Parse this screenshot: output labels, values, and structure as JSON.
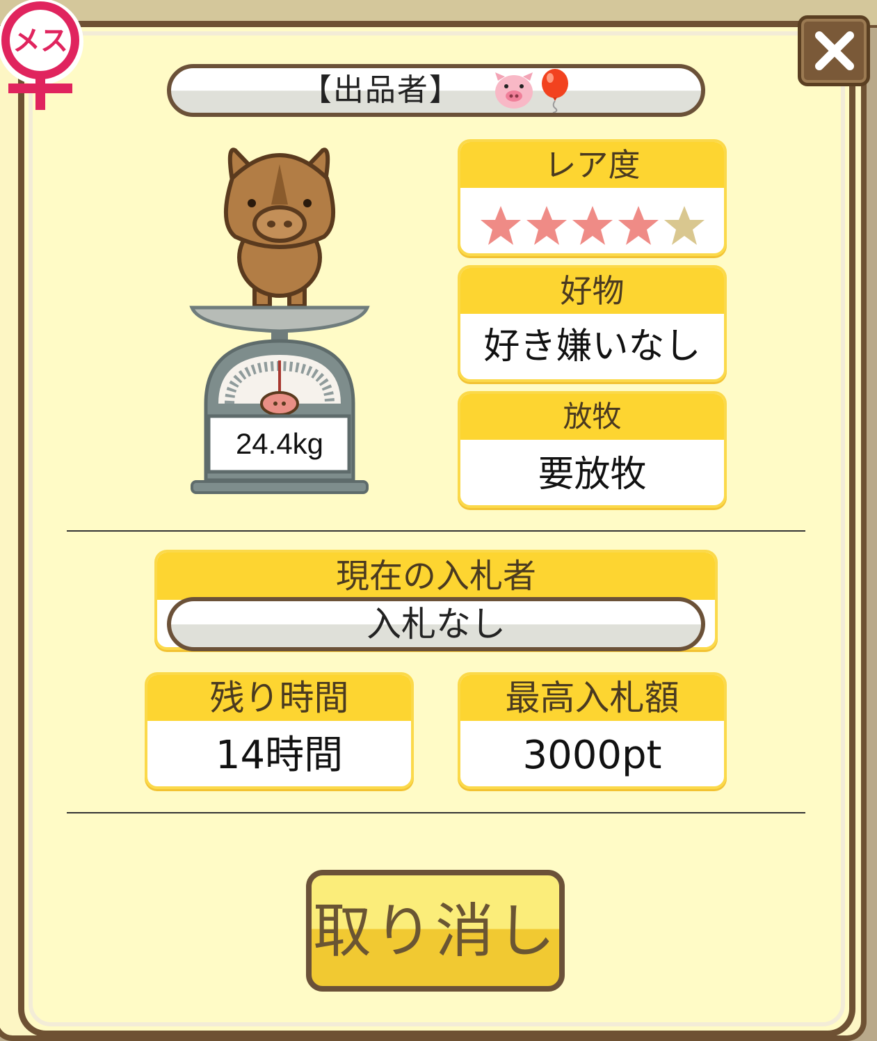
{
  "gender": {
    "label": "メス",
    "icon": "female-symbol-icon"
  },
  "seller": {
    "label": "【出品者】",
    "icons": [
      "pig-face-icon",
      "balloon-icon"
    ]
  },
  "animal": {
    "weight": "24.4kg",
    "icon": "boar-on-scale"
  },
  "rarity": {
    "label": "レア度",
    "stars": 4,
    "max_stars": 5
  },
  "likes": {
    "label": "好物",
    "value": "好き嫌いなし"
  },
  "grazing": {
    "label": "放牧",
    "value": "要放牧"
  },
  "bidder": {
    "label": "現在の入札者",
    "value": "入札なし"
  },
  "remaining": {
    "label": "残り時間",
    "value": "14時間"
  },
  "max_bid": {
    "label": "最高入札額",
    "value": "3000pt"
  },
  "cancel_label": "取り消し",
  "colors": {
    "header_yellow": "#fdd531",
    "frame_brown": "#6e5133",
    "panel_bg": "#fffbc6",
    "star_filled": "#ef8b86",
    "star_empty": "#d9c78f"
  }
}
